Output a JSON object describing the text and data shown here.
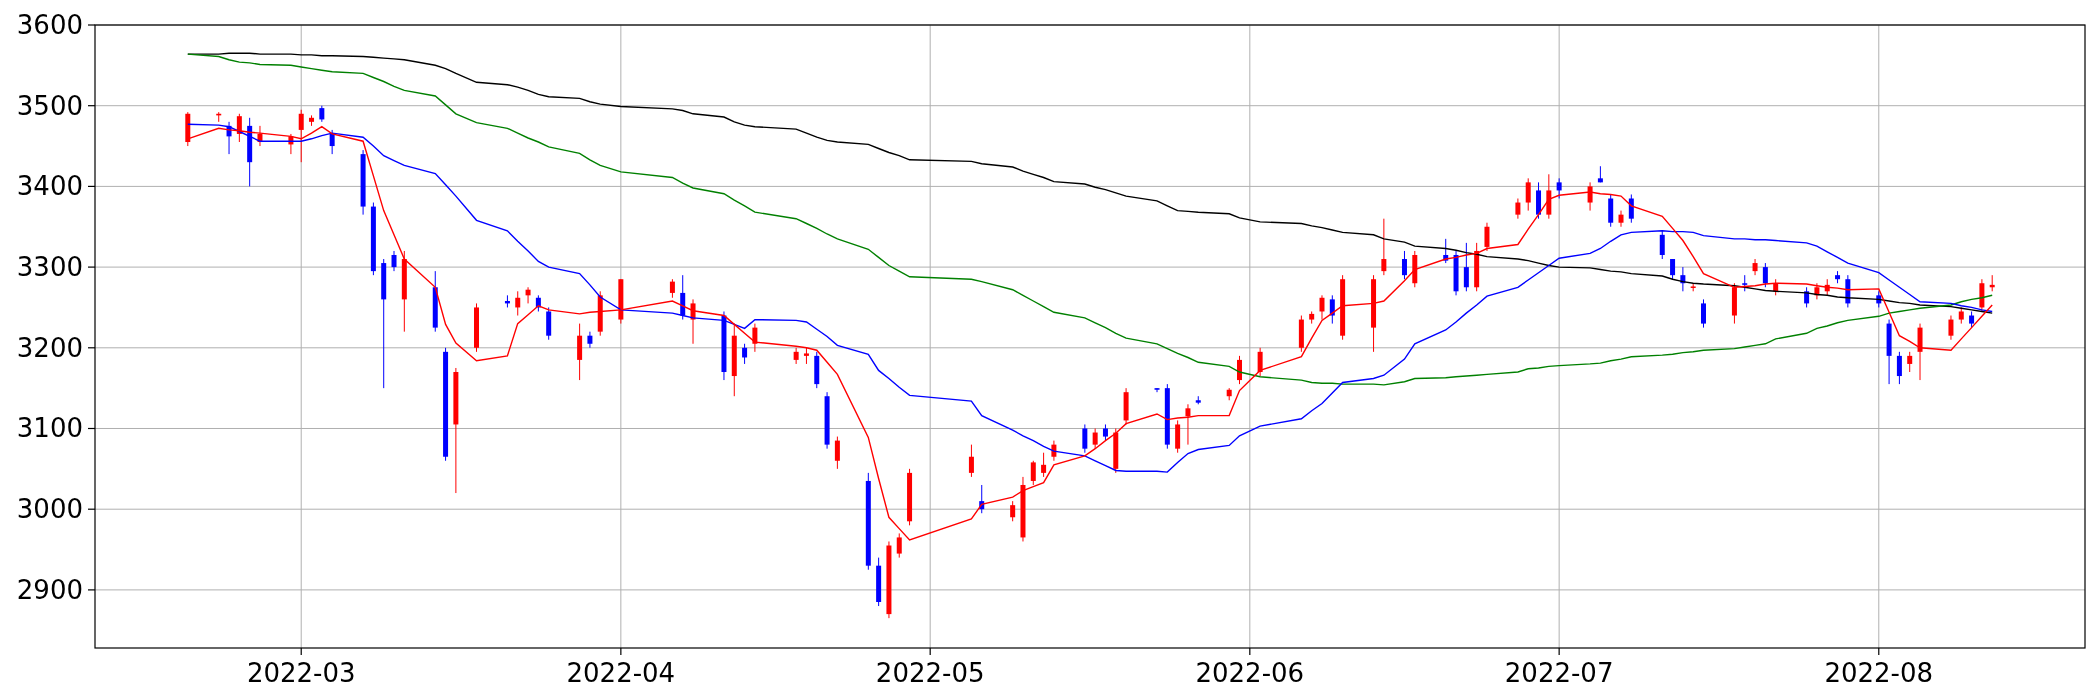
{
  "chart": {
    "chart_data": {
      "type": "candlestick",
      "grid": true,
      "xlim": [
        "2022-02-09",
        "2022-08-21"
      ],
      "ylim": [
        2828,
        3600
      ],
      "yticks": [
        2900,
        3000,
        3100,
        3200,
        3300,
        3400,
        3500,
        3600
      ],
      "xticks": [
        {
          "value": "2022-03-01",
          "label": "2022-03"
        },
        {
          "value": "2022-04-01",
          "label": "2022-04"
        },
        {
          "value": "2022-05-01",
          "label": "2022-05"
        },
        {
          "value": "2022-06-01",
          "label": "2022-06"
        },
        {
          "value": "2022-07-01",
          "label": "2022-07"
        },
        {
          "value": "2022-08-01",
          "label": "2022-08"
        }
      ],
      "x": [
        "2022-02-18",
        "2022-02-21",
        "2022-02-22",
        "2022-02-23",
        "2022-02-24",
        "2022-02-25",
        "2022-02-28",
        "2022-03-01",
        "2022-03-02",
        "2022-03-03",
        "2022-03-04",
        "2022-03-07",
        "2022-03-08",
        "2022-03-09",
        "2022-03-10",
        "2022-03-11",
        "2022-03-14",
        "2022-03-15",
        "2022-03-16",
        "2022-03-18",
        "2022-03-21",
        "2022-03-22",
        "2022-03-23",
        "2022-03-24",
        "2022-03-25",
        "2022-03-28",
        "2022-03-29",
        "2022-03-30",
        "2022-04-01",
        "2022-04-06",
        "2022-04-07",
        "2022-04-08",
        "2022-04-11",
        "2022-04-12",
        "2022-04-13",
        "2022-04-14",
        "2022-04-18",
        "2022-04-19",
        "2022-04-20",
        "2022-04-21",
        "2022-04-22",
        "2022-04-25",
        "2022-04-26",
        "2022-04-27",
        "2022-04-28",
        "2022-04-29",
        "2022-05-05",
        "2022-05-06",
        "2022-05-09",
        "2022-05-10",
        "2022-05-11",
        "2022-05-12",
        "2022-05-13",
        "2022-05-16",
        "2022-05-17",
        "2022-05-18",
        "2022-05-19",
        "2022-05-20",
        "2022-05-23",
        "2022-05-24",
        "2022-05-25",
        "2022-05-26",
        "2022-05-27",
        "2022-05-30",
        "2022-05-31",
        "2022-06-02",
        "2022-06-06",
        "2022-06-07",
        "2022-06-08",
        "2022-06-09",
        "2022-06-10",
        "2022-06-13",
        "2022-06-14",
        "2022-06-16",
        "2022-06-17",
        "2022-06-20",
        "2022-06-21",
        "2022-06-22",
        "2022-06-23",
        "2022-06-24",
        "2022-06-27",
        "2022-06-28",
        "2022-06-29",
        "2022-06-30",
        "2022-07-01",
        "2022-07-04",
        "2022-07-05",
        "2022-07-06",
        "2022-07-07",
        "2022-07-08",
        "2022-07-11",
        "2022-07-12",
        "2022-07-13",
        "2022-07-14",
        "2022-07-15",
        "2022-07-18",
        "2022-07-19",
        "2022-07-20",
        "2022-07-21",
        "2022-07-22",
        "2022-07-25",
        "2022-07-26",
        "2022-07-27",
        "2022-07-28",
        "2022-07-29",
        "2022-08-01",
        "2022-08-02",
        "2022-08-03",
        "2022-08-04",
        "2022-08-05",
        "2022-08-08",
        "2022-08-09",
        "2022-08-10",
        "2022-08-11",
        "2022-08-12"
      ],
      "ohlc": [
        [
          3455,
          3492,
          3450,
          3490
        ],
        [
          3488,
          3492,
          3480,
          3490
        ],
        [
          3475,
          3480,
          3440,
          3462
        ],
        [
          3465,
          3490,
          3455,
          3487
        ],
        [
          3475,
          3485,
          3400,
          3430
        ],
        [
          3455,
          3475,
          3450,
          3465
        ],
        [
          3452,
          3465,
          3440,
          3462
        ],
        [
          3470,
          3495,
          3430,
          3490
        ],
        [
          3480,
          3488,
          3475,
          3485
        ],
        [
          3497,
          3500,
          3480,
          3483
        ],
        [
          3465,
          3470,
          3440,
          3450
        ],
        [
          3440,
          3445,
          3365,
          3375
        ],
        [
          3375,
          3380,
          3290,
          3295
        ],
        [
          3305,
          3310,
          3150,
          3260
        ],
        [
          3315,
          3320,
          3295,
          3300
        ],
        [
          3260,
          3320,
          3220,
          3310
        ],
        [
          3275,
          3295,
          3220,
          3225
        ],
        [
          3195,
          3200,
          3060,
          3065
        ],
        [
          3105,
          3175,
          3020,
          3170
        ],
        [
          3200,
          3255,
          3195,
          3250
        ],
        [
          3258,
          3265,
          3250,
          3255
        ],
        [
          3250,
          3270,
          3240,
          3262
        ],
        [
          3265,
          3275,
          3255,
          3272
        ],
        [
          3262,
          3265,
          3245,
          3250
        ],
        [
          3245,
          3250,
          3210,
          3215
        ],
        [
          3185,
          3230,
          3160,
          3215
        ],
        [
          3215,
          3220,
          3200,
          3205
        ],
        [
          3220,
          3270,
          3215,
          3265
        ],
        [
          3235,
          3285,
          3230,
          3285
        ],
        [
          3268,
          3285,
          3262,
          3282
        ],
        [
          3268,
          3290,
          3235,
          3240
        ],
        [
          3235,
          3260,
          3205,
          3255
        ],
        [
          3240,
          3245,
          3160,
          3170
        ],
        [
          3165,
          3230,
          3140,
          3215
        ],
        [
          3200,
          3205,
          3180,
          3188
        ],
        [
          3205,
          3230,
          3195,
          3225
        ],
        [
          3185,
          3200,
          3180,
          3195
        ],
        [
          3190,
          3200,
          3180,
          3193
        ],
        [
          3190,
          3195,
          3150,
          3155
        ],
        [
          3140,
          3145,
          3075,
          3080
        ],
        [
          3060,
          3090,
          3050,
          3085
        ],
        [
          3035,
          3045,
          2925,
          2930
        ],
        [
          2930,
          2940,
          2880,
          2885
        ],
        [
          2870,
          2960,
          2865,
          2955
        ],
        [
          2945,
          2970,
          2940,
          2965
        ],
        [
          2985,
          3050,
          2980,
          3045
        ],
        [
          3045,
          3080,
          3040,
          3065
        ],
        [
          3010,
          3030,
          2995,
          3000
        ],
        [
          2990,
          3010,
          2985,
          3005
        ],
        [
          2965,
          3040,
          2960,
          3030
        ],
        [
          3035,
          3060,
          3030,
          3058
        ],
        [
          3045,
          3070,
          3040,
          3055
        ],
        [
          3065,
          3085,
          3060,
          3080
        ],
        [
          3100,
          3105,
          3070,
          3075
        ],
        [
          3080,
          3100,
          3075,
          3095
        ],
        [
          3100,
          3105,
          3085,
          3090
        ],
        [
          3050,
          3100,
          3045,
          3095
        ],
        [
          3110,
          3150,
          3105,
          3145
        ],
        [
          3150,
          3150,
          3145,
          3148
        ],
        [
          3150,
          3155,
          3075,
          3080
        ],
        [
          3075,
          3110,
          3070,
          3105
        ],
        [
          3115,
          3130,
          3080,
          3125
        ],
        [
          3135,
          3140,
          3130,
          3132
        ],
        [
          3140,
          3150,
          3135,
          3148
        ],
        [
          3160,
          3190,
          3155,
          3185
        ],
        [
          3170,
          3200,
          3165,
          3195
        ],
        [
          3200,
          3240,
          3195,
          3235
        ],
        [
          3235,
          3245,
          3230,
          3242
        ],
        [
          3245,
          3265,
          3235,
          3262
        ],
        [
          3260,
          3265,
          3230,
          3240
        ],
        [
          3215,
          3290,
          3210,
          3285
        ],
        [
          3225,
          3290,
          3195,
          3285
        ],
        [
          3295,
          3360,
          3290,
          3310
        ],
        [
          3310,
          3320,
          3285,
          3290
        ],
        [
          3280,
          3320,
          3275,
          3315
        ],
        [
          3315,
          3335,
          3305,
          3308
        ],
        [
          3315,
          3320,
          3265,
          3270
        ],
        [
          3300,
          3330,
          3270,
          3275
        ],
        [
          3275,
          3330,
          3270,
          3320
        ],
        [
          3325,
          3355,
          3320,
          3350
        ],
        [
          3365,
          3385,
          3360,
          3380
        ],
        [
          3380,
          3410,
          3370,
          3405
        ],
        [
          3395,
          3405,
          3360,
          3365
        ],
        [
          3365,
          3415,
          3360,
          3395
        ],
        [
          3405,
          3410,
          3385,
          3395
        ],
        [
          3380,
          3405,
          3370,
          3400
        ],
        [
          3410,
          3425,
          3405,
          3405
        ],
        [
          3385,
          3390,
          3350,
          3355
        ],
        [
          3355,
          3370,
          3350,
          3365
        ],
        [
          3385,
          3390,
          3355,
          3360
        ],
        [
          3340,
          3345,
          3310,
          3315
        ],
        [
          3310,
          3310,
          3285,
          3290
        ],
        [
          3290,
          3300,
          3270,
          3280
        ],
        [
          3275,
          3280,
          3270,
          3276
        ],
        [
          3255,
          3260,
          3225,
          3230
        ],
        [
          3240,
          3280,
          3230,
          3275
        ],
        [
          3280,
          3290,
          3270,
          3278
        ],
        [
          3295,
          3310,
          3290,
          3305
        ],
        [
          3300,
          3305,
          3275,
          3280
        ],
        [
          3270,
          3285,
          3265,
          3280
        ],
        [
          3270,
          3275,
          3250,
          3255
        ],
        [
          3265,
          3280,
          3260,
          3275
        ],
        [
          3270,
          3285,
          3265,
          3278
        ],
        [
          3290,
          3295,
          3280,
          3285
        ],
        [
          3285,
          3290,
          3250,
          3255
        ],
        [
          3265,
          3270,
          3250,
          3255
        ],
        [
          3230,
          3235,
          3155,
          3190
        ],
        [
          3190,
          3195,
          3155,
          3165
        ],
        [
          3180,
          3195,
          3170,
          3190
        ],
        [
          3195,
          3230,
          3160,
          3225
        ],
        [
          3215,
          3240,
          3210,
          3235
        ],
        [
          3235,
          3250,
          3230,
          3245
        ],
        [
          3240,
          3245,
          3225,
          3230
        ],
        [
          3250,
          3285,
          3245,
          3280
        ],
        [
          3275,
          3290,
          3270,
          3278
        ]
      ],
      "series": [
        {
          "type": "line",
          "color": "#000000",
          "values": [
            3564,
            3564,
            3565,
            3565,
            3565,
            3564,
            3564,
            3563,
            3563,
            3562,
            3562,
            3561,
            3560,
            3559,
            3558,
            3557,
            3550,
            3546,
            3540,
            3529,
            3526,
            3523,
            3519,
            3514,
            3511,
            3509,
            3505,
            3502,
            3499,
            3496,
            3494,
            3490,
            3486,
            3480,
            3476,
            3474,
            3471,
            3466,
            3461,
            3457,
            3455,
            3452,
            3447,
            3442,
            3438,
            3433,
            3431,
            3428,
            3424,
            3419,
            3415,
            3411,
            3406,
            3403,
            3399,
            3396,
            3392,
            3388,
            3382,
            3376,
            3370,
            3369,
            3368,
            3366,
            3361,
            3356,
            3354,
            3351,
            3349,
            3346,
            3343,
            3340,
            3335,
            3331,
            3326,
            3323,
            3321,
            3318,
            3316,
            3313,
            3310,
            3308,
            3305,
            3302,
            3300,
            3299,
            3297,
            3295,
            3294,
            3292,
            3289,
            3285,
            3282,
            3280,
            3279,
            3277,
            3275,
            3273,
            3271,
            3270,
            3268,
            3266,
            3265,
            3263,
            3262,
            3260,
            3258,
            3256,
            3255,
            3253,
            3251,
            3249,
            3247,
            3245,
            3243
          ]
        },
        {
          "type": "line",
          "color": "#008000",
          "values": [
            3564,
            3561,
            3557,
            3554,
            3553,
            3551,
            3550,
            3548,
            3546,
            3544,
            3542,
            3540,
            3535,
            3530,
            3524,
            3519,
            3512,
            3501,
            3490,
            3479,
            3472,
            3466,
            3460,
            3455,
            3449,
            3441,
            3433,
            3426,
            3418,
            3411,
            3404,
            3398,
            3391,
            3383,
            3376,
            3368,
            3360,
            3354,
            3348,
            3341,
            3335,
            3322,
            3312,
            3302,
            3295,
            3288,
            3285,
            3282,
            3272,
            3265,
            3258,
            3251,
            3244,
            3237,
            3231,
            3225,
            3218,
            3212,
            3205,
            3199,
            3193,
            3188,
            3182,
            3177,
            3170,
            3164,
            3160,
            3157,
            3156,
            3156,
            3155,
            3155,
            3154,
            3158,
            3162,
            3163,
            3164,
            3165,
            3166,
            3167,
            3170,
            3174,
            3175,
            3177,
            3178,
            3180,
            3181,
            3184,
            3186,
            3189,
            3191,
            3192,
            3194,
            3195,
            3197,
            3199,
            3201,
            3203,
            3205,
            3211,
            3218,
            3224,
            3227,
            3231,
            3234,
            3239,
            3243,
            3245,
            3247,
            3249,
            3253,
            3257,
            3260,
            3262,
            3265
          ]
        },
        {
          "type": "line",
          "color": "#0000ff",
          "values": [
            3477,
            3476,
            3474,
            3468,
            3462,
            3456,
            3456,
            3456,
            3459,
            3463,
            3466,
            3461,
            3450,
            3438,
            3432,
            3426,
            3416,
            3402,
            3388,
            3358,
            3345,
            3332,
            3320,
            3307,
            3300,
            3292,
            3278,
            3263,
            3247,
            3243,
            3240,
            3237,
            3234,
            3229,
            3224,
            3235,
            3234,
            3232,
            3223,
            3214,
            3203,
            3192,
            3172,
            3162,
            3151,
            3141,
            3134,
            3116,
            3098,
            3091,
            3085,
            3078,
            3072,
            3066,
            3060,
            3054,
            3048,
            3047,
            3047,
            3046,
            3058,
            3069,
            3074,
            3079,
            3091,
            3103,
            3112,
            3122,
            3131,
            3144,
            3157,
            3162,
            3166,
            3186,
            3205,
            3222,
            3232,
            3243,
            3253,
            3264,
            3275,
            3284,
            3293,
            3302,
            3311,
            3317,
            3323,
            3332,
            3340,
            3343,
            3345,
            3344,
            3344,
            3343,
            3339,
            3335,
            3335,
            3334,
            3334,
            3333,
            3330,
            3326,
            3319,
            3312,
            3305,
            3293,
            3284,
            3275,
            3266,
            3257,
            3255,
            3252,
            3250,
            3247,
            3245
          ]
        },
        {
          "type": "line",
          "color": "#ff0000",
          "values": [
            3459,
            3472,
            3470,
            3469,
            3467,
            3466,
            3462,
            3459,
            3466,
            3474,
            3465,
            3456,
            3413,
            3370,
            3340,
            3310,
            3275,
            3229,
            3206,
            3184,
            3190,
            3230,
            3241,
            3252,
            3247,
            3242,
            3244,
            3245,
            3247,
            3258,
            3252,
            3246,
            3240,
            3229,
            3218,
            3207,
            3202,
            3200,
            3197,
            3182,
            3167,
            3089,
            3038,
            2990,
            2976,
            2962,
            2988,
            3006,
            3015,
            3023,
            3028,
            3033,
            3055,
            3066,
            3075,
            3085,
            3094,
            3106,
            3118,
            3111,
            3113,
            3114,
            3116,
            3116,
            3147,
            3172,
            3189,
            3212,
            3234,
            3243,
            3252,
            3255,
            3258,
            3283,
            3297,
            3310,
            3312,
            3315,
            3317,
            3323,
            3328,
            3347,
            3365,
            3384,
            3389,
            3393,
            3391,
            3390,
            3388,
            3376,
            3363,
            3348,
            3333,
            3313,
            3292,
            3275,
            3276,
            3277,
            3279,
            3280,
            3279,
            3277,
            3275,
            3274,
            3272,
            3273,
            3244,
            3215,
            3208,
            3200,
            3197,
            3211,
            3225,
            3239,
            3253
          ]
        }
      ]
    }
  }
}
